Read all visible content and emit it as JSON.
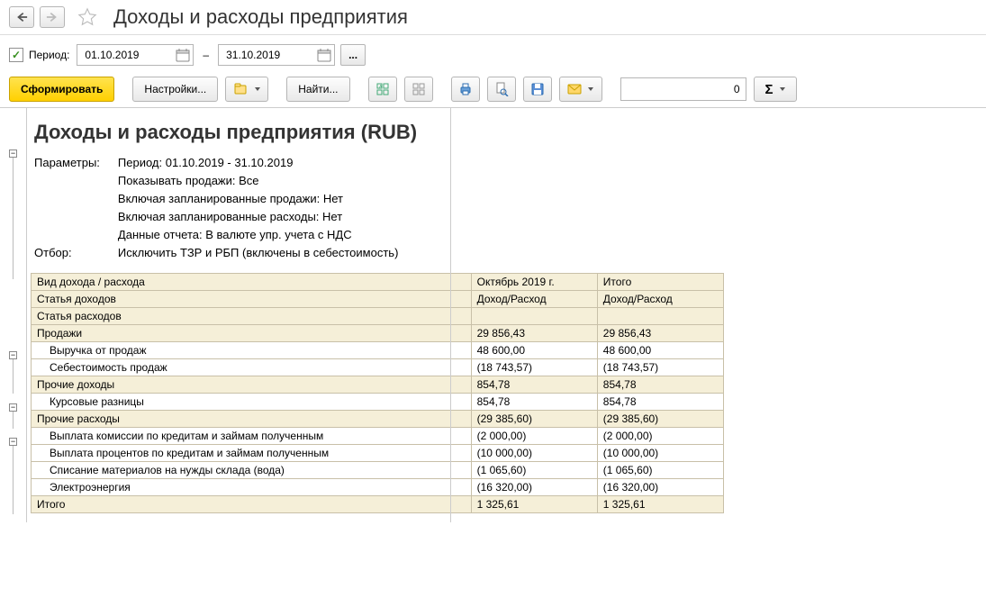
{
  "header": {
    "title": "Доходы и расходы предприятия"
  },
  "period": {
    "label": "Период:",
    "from": "01.10.2019",
    "to": "31.10.2019",
    "dash": "–",
    "dots": "..."
  },
  "toolbar": {
    "generate": "Сформировать",
    "settings": "Настройки...",
    "find": "Найти...",
    "sum_value": "0",
    "sigma": "Σ"
  },
  "report": {
    "title": "Доходы и расходы предприятия (RUB)",
    "params_label": "Параметры:",
    "filter_label": "Отбор:",
    "params": [
      "Период: 01.10.2019 - 31.10.2019",
      "Показывать продажи: Все",
      "Включая запланированные продажи: Нет",
      "Включая запланированные расходы: Нет",
      "Данные отчета: В валюте упр. учета с НДС"
    ],
    "filter_text": "Исключить ТЗР и РБП (включены в себестоимость)",
    "headers": {
      "h1": "Вид дохода / расхода",
      "h2": "Статья доходов",
      "h3": "Статья расходов",
      "c1": "Октябрь 2019 г.",
      "c2": "Итого",
      "sub": "Доход/Расход"
    },
    "rows": [
      {
        "type": "group",
        "label": "Продажи",
        "v1": "29 856,43",
        "v2": "29 856,43"
      },
      {
        "type": "item",
        "label": "Выручка от продаж",
        "v1": "48 600,00",
        "v2": "48 600,00"
      },
      {
        "type": "item",
        "label": "Себестоимость продаж",
        "v1": "(18 743,57)",
        "v2": "(18 743,57)"
      },
      {
        "type": "group",
        "label": "Прочие доходы",
        "v1": "854,78",
        "v2": "854,78"
      },
      {
        "type": "item",
        "label": "Курсовые разницы",
        "v1": "854,78",
        "v2": "854,78"
      },
      {
        "type": "group",
        "label": "Прочие расходы",
        "v1": "(29 385,60)",
        "v2": "(29 385,60)"
      },
      {
        "type": "item",
        "label": "Выплата комиссии по кредитам и займам полученным",
        "v1": "(2 000,00)",
        "v2": "(2 000,00)"
      },
      {
        "type": "item",
        "label": "Выплата процентов по кредитам и займам полученным",
        "v1": "(10 000,00)",
        "v2": "(10 000,00)"
      },
      {
        "type": "item",
        "label": "Списание материалов на нужды склада (вода)",
        "v1": "(1 065,60)",
        "v2": "(1 065,60)"
      },
      {
        "type": "item",
        "label": "Электроэнергия",
        "v1": "(16 320,00)",
        "v2": "(16 320,00)"
      },
      {
        "type": "total",
        "label": "Итого",
        "v1": "1 325,61",
        "v2": "1 325,61"
      }
    ]
  }
}
